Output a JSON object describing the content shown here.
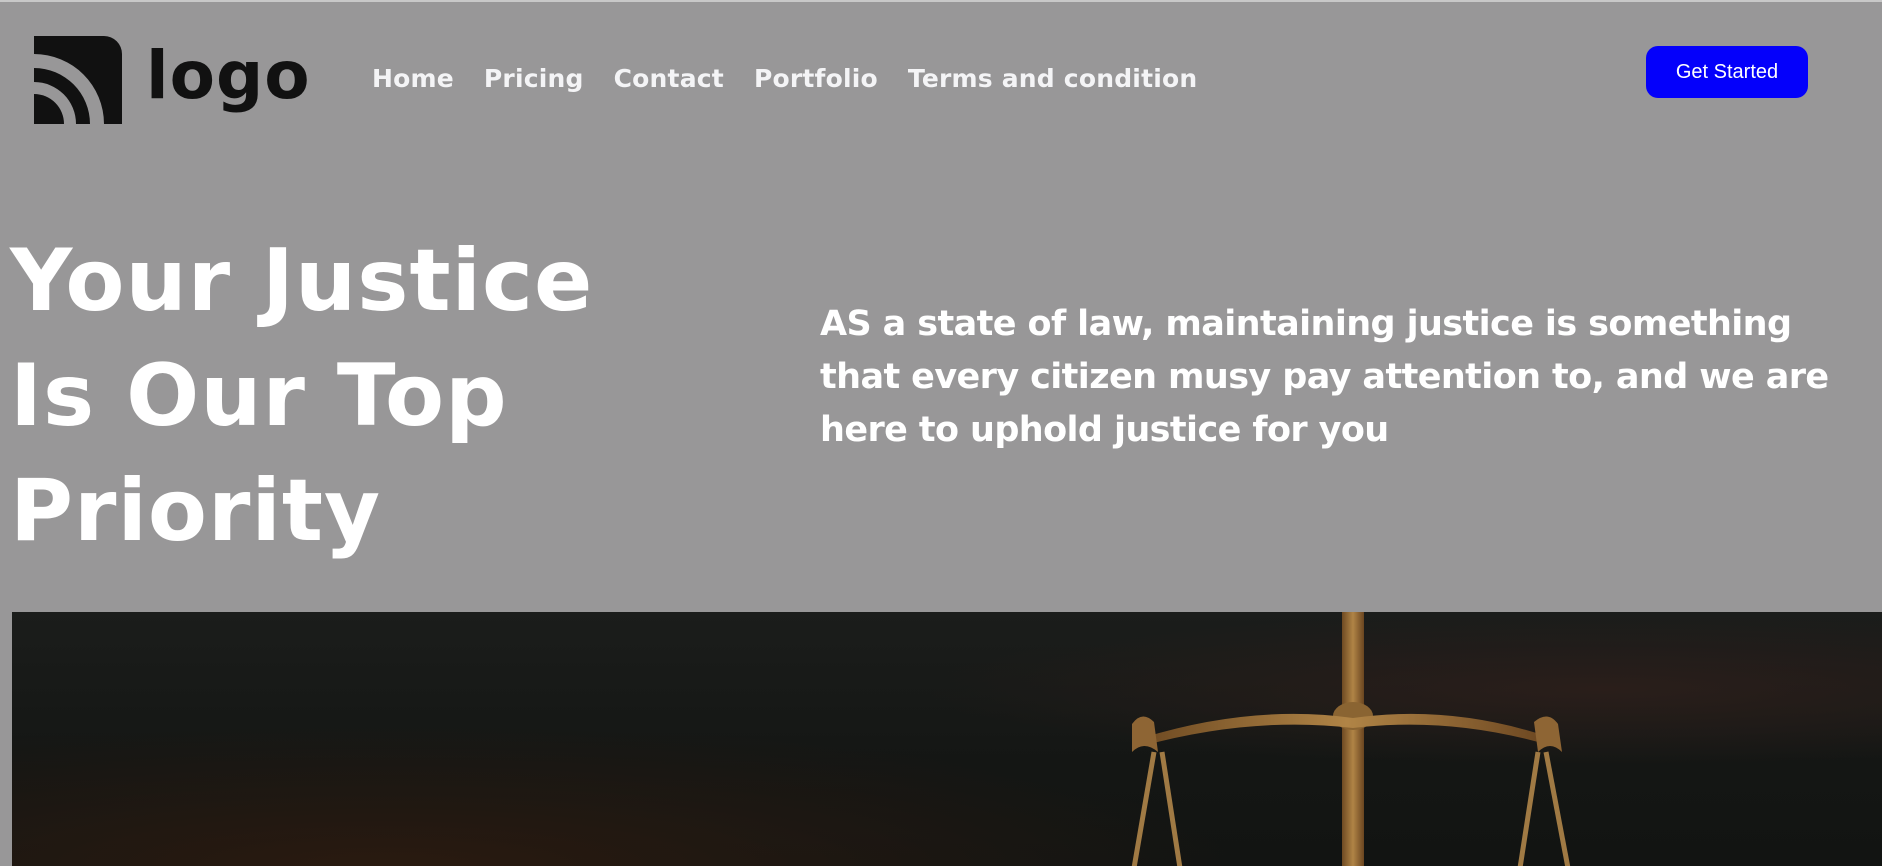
{
  "header": {
    "logo": {
      "text": "logo",
      "icon": "logo-arcs-icon"
    },
    "nav": [
      {
        "label": "Home"
      },
      {
        "label": "Pricing"
      },
      {
        "label": "Contact"
      },
      {
        "label": "Portfolio"
      },
      {
        "label": "Terms and condition"
      }
    ],
    "cta_label": "Get Started"
  },
  "hero": {
    "title_lines": [
      "Your Justice",
      "Is Our Top",
      "Priority"
    ],
    "description": "AS a state of law, maintaining justice is something that every citizen musy pay attention to, and we are here to uphold justice for you"
  },
  "image": {
    "subject": "scales-of-justice-image"
  },
  "colors": {
    "background": "#989798",
    "cta": "#0400fb",
    "text": "#ffffff",
    "logo": "#111111"
  }
}
